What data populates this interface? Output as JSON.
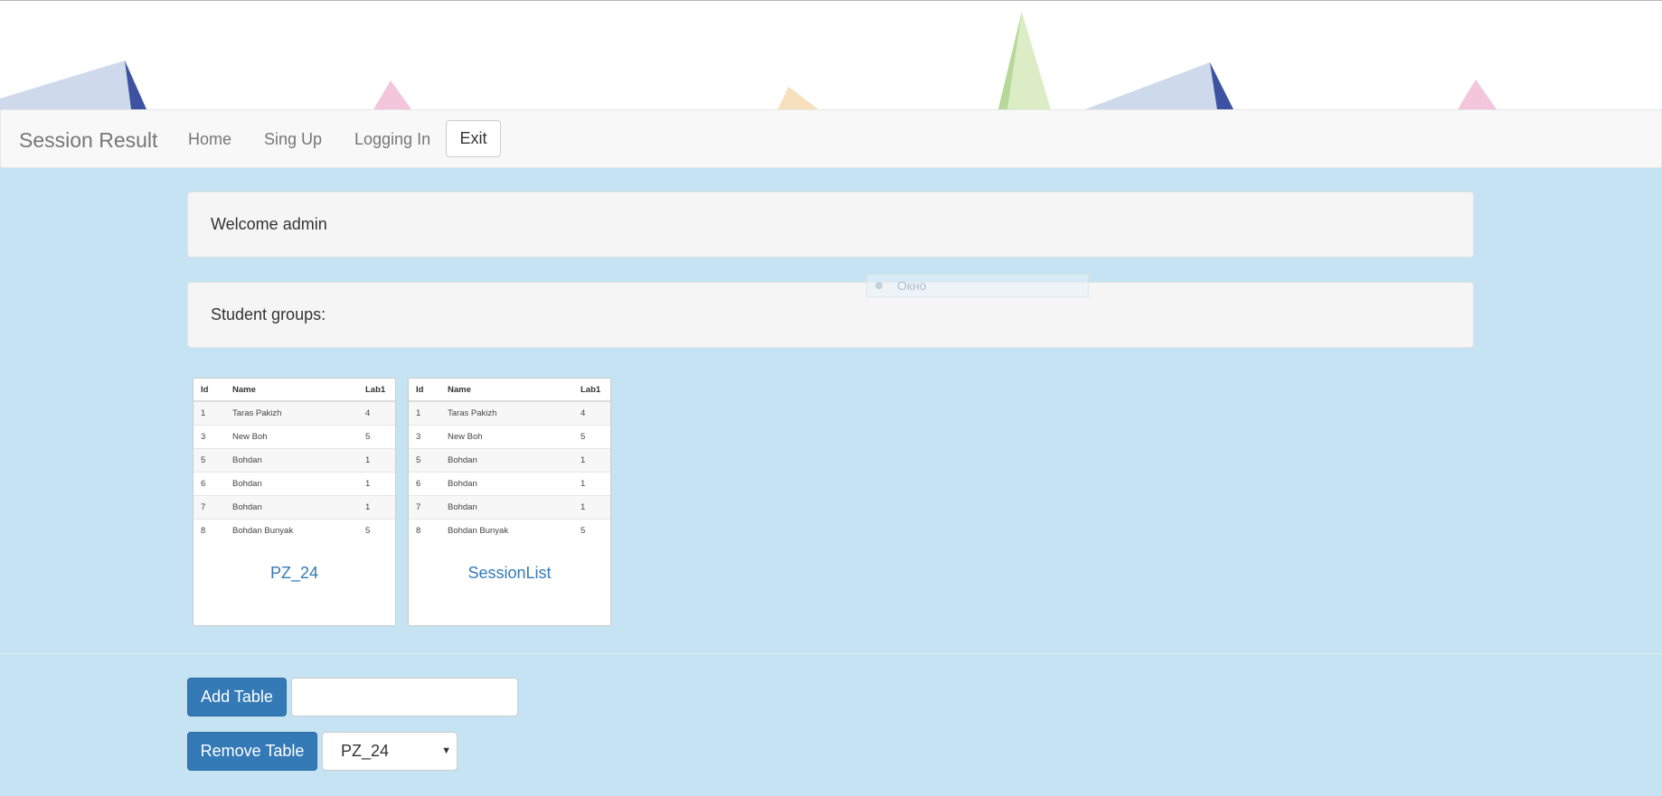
{
  "navbar": {
    "brand": "Session Result",
    "links": [
      "Home",
      "Sing Up",
      "Logging In"
    ],
    "exit_label": "Exit"
  },
  "welcome_text": "Welcome admin",
  "groups_heading": "Student groups:",
  "ghost_tooltip": {
    "label": "Окно"
  },
  "cards": [
    {
      "title": "PZ_24",
      "columns": [
        "Id",
        "Name",
        "Lab1"
      ],
      "rows": [
        [
          "1",
          "Taras Pakizh",
          "4"
        ],
        [
          "3",
          "New Boh",
          "5"
        ],
        [
          "5",
          "Bohdan",
          "1"
        ],
        [
          "6",
          "Bohdan",
          "1"
        ],
        [
          "7",
          "Bohdan",
          "1"
        ],
        [
          "8",
          "Bohdan Bunyak",
          "5"
        ]
      ]
    },
    {
      "title": "SessionList",
      "columns": [
        "Id",
        "Name",
        "Lab1"
      ],
      "rows": [
        [
          "1",
          "Taras Pakizh",
          "4"
        ],
        [
          "3",
          "New Boh",
          "5"
        ],
        [
          "5",
          "Bohdan",
          "1"
        ],
        [
          "6",
          "Bohdan",
          "1"
        ],
        [
          "7",
          "Bohdan",
          "1"
        ],
        [
          "8",
          "Bohdan Bunyak",
          "5"
        ]
      ]
    }
  ],
  "actions": {
    "add_label": "Add Table",
    "add_input_value": "",
    "remove_label": "Remove Table",
    "remove_select_value": "PZ_24"
  },
  "colors": {
    "background": "#c5e3f2",
    "primary": "#337ab7",
    "link": "#337ab7",
    "navbar": "#f8f8f8"
  }
}
